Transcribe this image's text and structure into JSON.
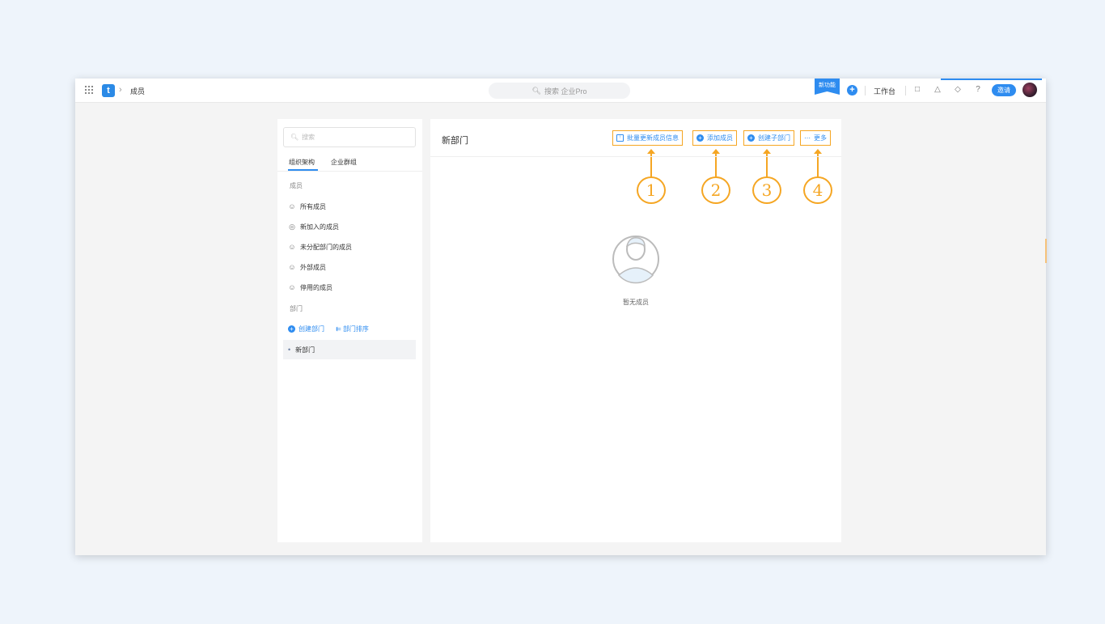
{
  "topbar": {
    "breadcrumb": "成员",
    "search_placeholder": "搜索 企业Pro",
    "new_feature_badge": "新功能",
    "workbench": "工作台",
    "invite_button": "邀请",
    "logo_letter": "t"
  },
  "sidebar": {
    "search_placeholder": "搜索",
    "tabs": [
      "组织架构",
      "企业群组"
    ],
    "members_section": "成员",
    "member_items": [
      "所有成员",
      "新加入的成员",
      "未分配部门的成员",
      "外部成员",
      "停用的成员"
    ],
    "dept_section": "部门",
    "create_dept": "创建部门",
    "sort_dept": "部门排序",
    "dept_items": [
      "新部门"
    ]
  },
  "main": {
    "title": "新部门",
    "actions": [
      "批量更新成员信息",
      "添加成员",
      "创建子部门",
      "更多"
    ],
    "callouts": [
      "1",
      "2",
      "3",
      "4"
    ],
    "empty_text": "暂无成员"
  },
  "colors": {
    "accent": "#2e8cf0",
    "highlight": "#f5a623",
    "background": "#eef4fb"
  }
}
